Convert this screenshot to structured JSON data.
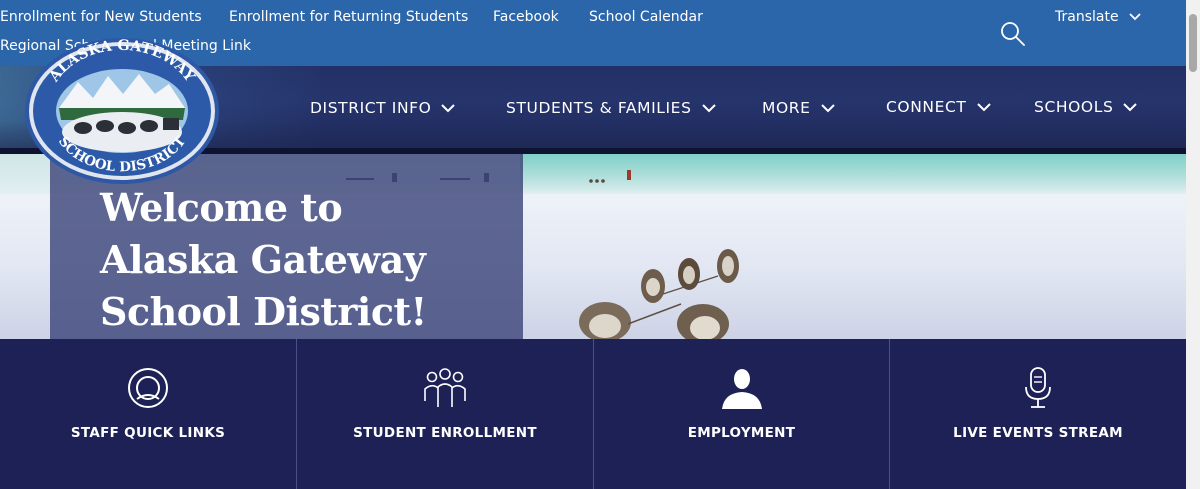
{
  "top_links": [
    {
      "label": "Enrollment for New Students"
    },
    {
      "label": "Enrollment for Returning Students"
    },
    {
      "label": "Facebook"
    },
    {
      "label": "School Calendar"
    },
    {
      "label": "Regional School Board Meeting Link"
    }
  ],
  "search": {
    "icon": "search-icon"
  },
  "translate": {
    "label": "Translate",
    "icon": "chevron-down-icon"
  },
  "logo": {
    "top_text": "ALASKA GATEWAY",
    "bottom_text": "SCHOOL DISTRICT"
  },
  "nav": [
    {
      "label": "DISTRICT INFO"
    },
    {
      "label": "STUDENTS & FAMILIES"
    },
    {
      "label": "MORE"
    },
    {
      "label": "CONNECT"
    },
    {
      "label": "SCHOOLS"
    }
  ],
  "hero": {
    "welcome_line1": "Welcome to",
    "welcome_line2": "Alaska Gateway",
    "welcome_line3": "School District!"
  },
  "tiles": [
    {
      "label": "STAFF QUICK LINKS",
      "icon": "headset-circle-icon"
    },
    {
      "label": "STUDENT ENROLLMENT",
      "icon": "group-icon"
    },
    {
      "label": "EMPLOYMENT",
      "icon": "person-icon"
    },
    {
      "label": "LIVE EVENTS STREAM",
      "icon": "microphone-icon"
    }
  ],
  "colors": {
    "top_bar": "#2b66ab",
    "nav_band": "#233066",
    "tiles_bg": "#1d2155",
    "welcome_panel": "#3a4278"
  }
}
